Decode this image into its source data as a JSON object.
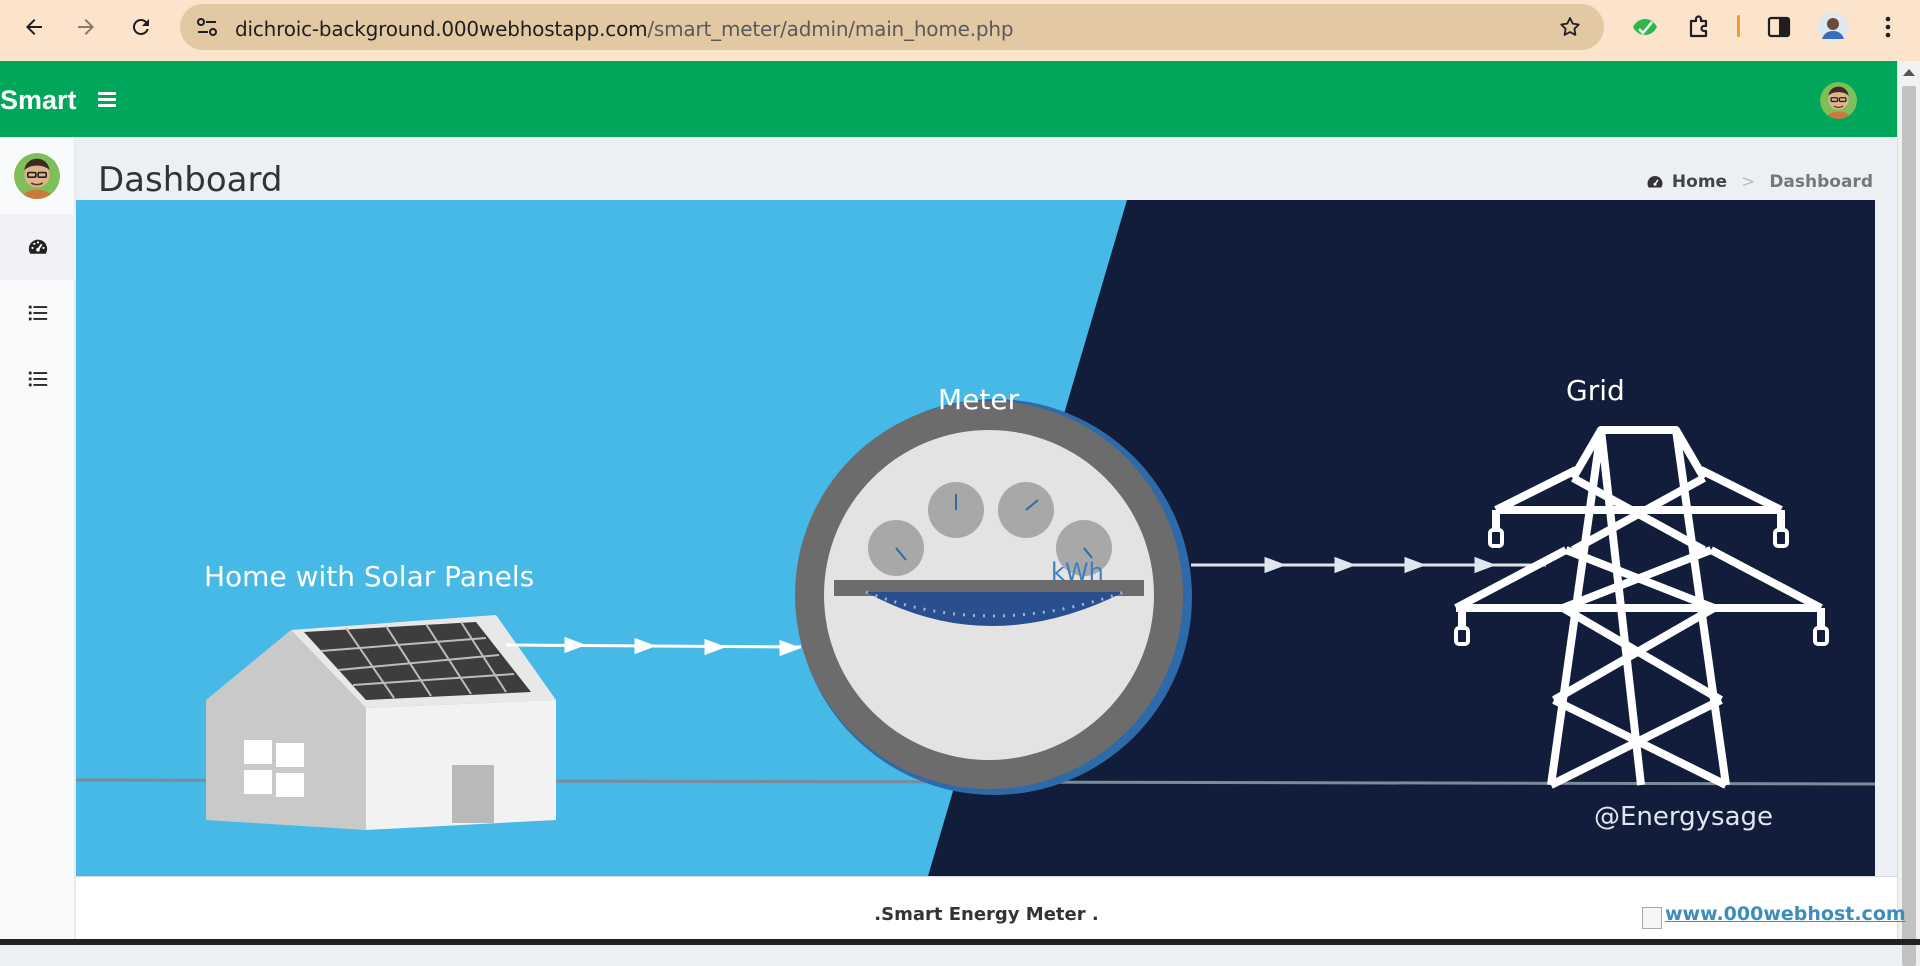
{
  "browser": {
    "url_domain": "dichroic-background.000webhostapp.com",
    "url_path": "/smart_meter/admin/main_home.php"
  },
  "header": {
    "brand": "Smart"
  },
  "content": {
    "page_title": "Dashboard",
    "breadcrumb": {
      "home": "Home",
      "current": "Dashboard"
    }
  },
  "sidebar": {
    "items": [
      {
        "icon": "dashboard-icon",
        "active": true
      },
      {
        "icon": "list-icon",
        "active": false
      },
      {
        "icon": "list-icon",
        "active": false
      }
    ]
  },
  "hero": {
    "home_label": "Home with Solar Panels",
    "meter_label": "Meter",
    "grid_label": "Grid",
    "unit_label": "kWh",
    "credit": "@Energysage",
    "colors": {
      "sky": "#47b9e7",
      "night": "#111d3a"
    }
  },
  "footer": {
    "text": ".Smart Energy Meter .",
    "badge": "www.000webhost.com"
  },
  "colors": {
    "accent": "#00a65a",
    "chrome": "#fbe3cc"
  }
}
